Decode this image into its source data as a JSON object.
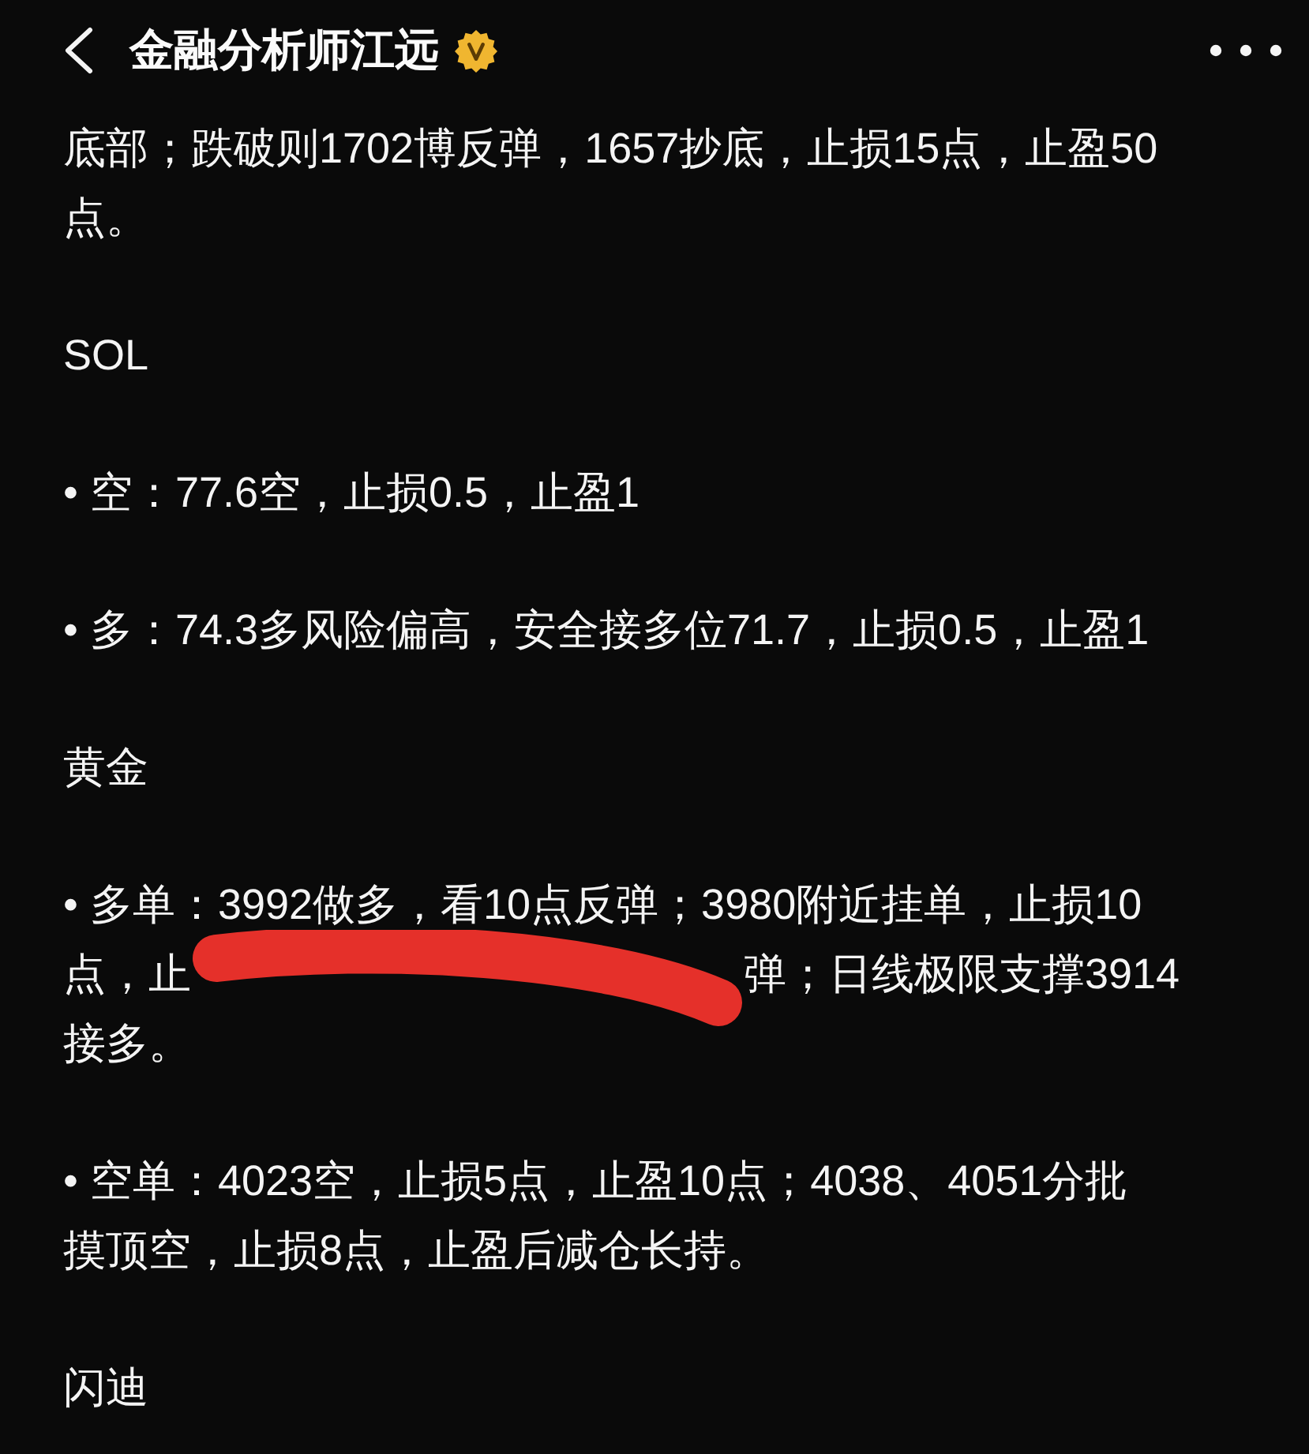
{
  "header": {
    "title": "金融分析师江远",
    "verified": true
  },
  "paragraphs": [
    {
      "lines": [
        "底部；跌破则1702博反弹，1657抄底，止损15点，止盈50",
        "点。"
      ]
    },
    {
      "lines": [
        "SOL"
      ]
    },
    {
      "lines": [
        "• 空：77.6空，止损0.5，止盈1"
      ]
    },
    {
      "lines": [
        "• 多：74.3多风险偏高，安全接多位71.7，止损0.5，止盈1"
      ]
    },
    {
      "lines": [
        "黄金"
      ]
    },
    {
      "lines": [
        "• 多单：3992做多，看10点反弹；3980附近挂单，止损10",
        [
          "点，止",
          "弹；日线极限支撑3914"
        ],
        "接多。"
      ]
    },
    {
      "lines": [
        "• 空单：4023空，止损5点，止盈10点；4038、4051分批",
        "摸顶空，止损8点，止盈后减仓长持。"
      ]
    },
    {
      "lines": [
        "闪迪"
      ]
    }
  ]
}
